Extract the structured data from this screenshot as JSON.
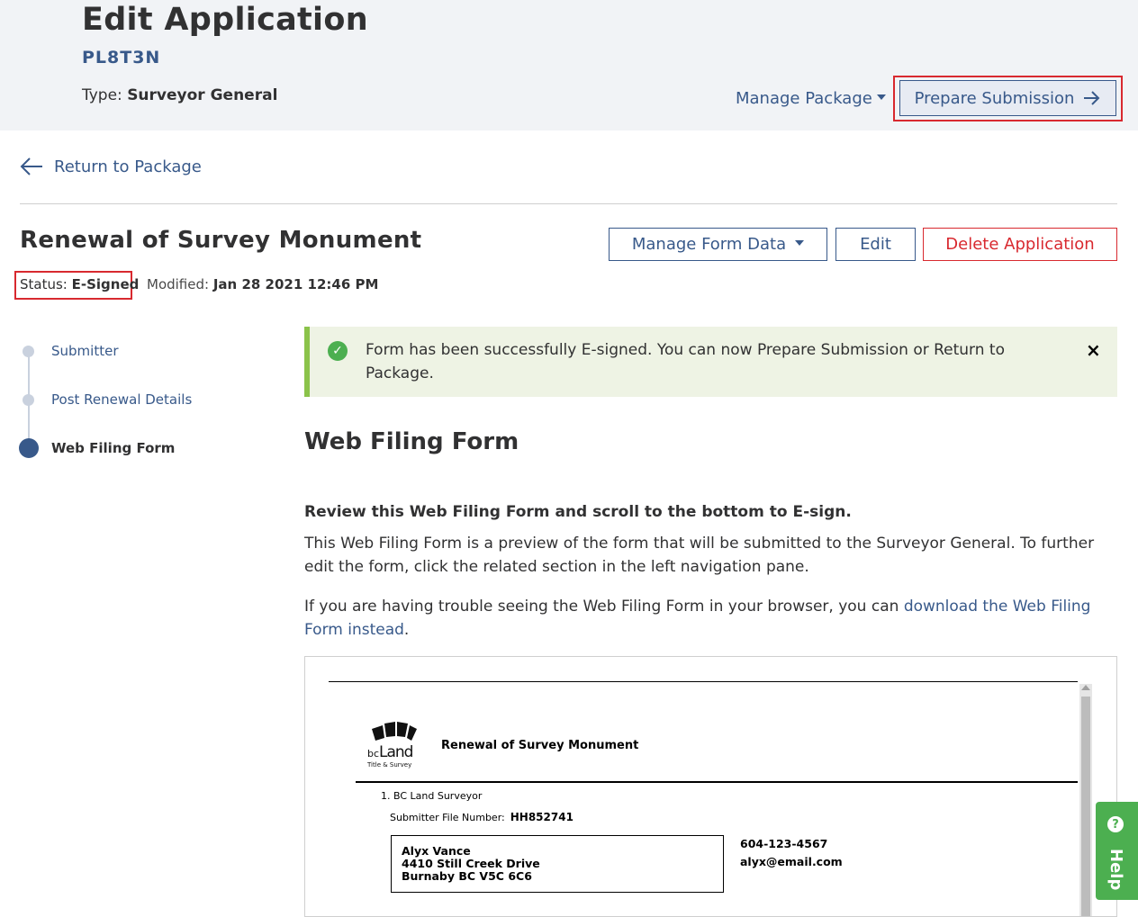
{
  "header": {
    "title": "Edit Application",
    "code": "PL8T3N",
    "type_label": "Type:",
    "type_value": "Surveyor General",
    "manage_package": "Manage Package",
    "prepare_submission": "Prepare Submission"
  },
  "nav": {
    "return_label": "Return to Package"
  },
  "form": {
    "title": "Renewal of Survey Monument",
    "buttons": {
      "manage_form_data": "Manage Form Data",
      "edit": "Edit",
      "delete": "Delete Application"
    },
    "status_label": "Status:",
    "status_value": "E-Signed",
    "modified_label": "Modified:",
    "modified_value": "Jan 28 2021 12:46 PM"
  },
  "steps": [
    {
      "label": "Submitter",
      "active": false
    },
    {
      "label": "Post Renewal Details",
      "active": false
    },
    {
      "label": "Web Filing Form",
      "active": true
    }
  ],
  "alert": {
    "text": "Form has been successfully E-signed. You can now Prepare Submission or Return to Package.",
    "close": "×"
  },
  "content": {
    "section_title": "Web Filing Form",
    "review_heading": "Review this Web Filing Form and scroll to the bottom to E-sign.",
    "para1": "This Web Filing Form is a preview of the form that will be submitted to the Surveyor General. To further edit the form, click the related section in the left navigation pane.",
    "para2_prefix": "If you are having trouble seeing the Web Filing Form in your browser, you can ",
    "para2_link": "download the Web Filing Form instead",
    "para2_suffix": "."
  },
  "preview": {
    "logo_text_1": "bc",
    "logo_text_2": "Land",
    "logo_text_3": "Title & Survey",
    "title": "Renewal of Survey Monument",
    "section": "1. BC Land Surveyor",
    "sfn_label": "Submitter File Number:",
    "sfn_value": "HH852741",
    "address": [
      "Alyx Vance",
      "4410 Still Creek Drive",
      "Burnaby BC V5C 6C6"
    ],
    "phone": "604-123-4567",
    "email": "alyx@email.com"
  },
  "help": {
    "label": "Help"
  },
  "colors": {
    "primary": "#38598a",
    "danger": "#d8292f",
    "success": "#4caf50",
    "highlight": "#d8292f"
  }
}
